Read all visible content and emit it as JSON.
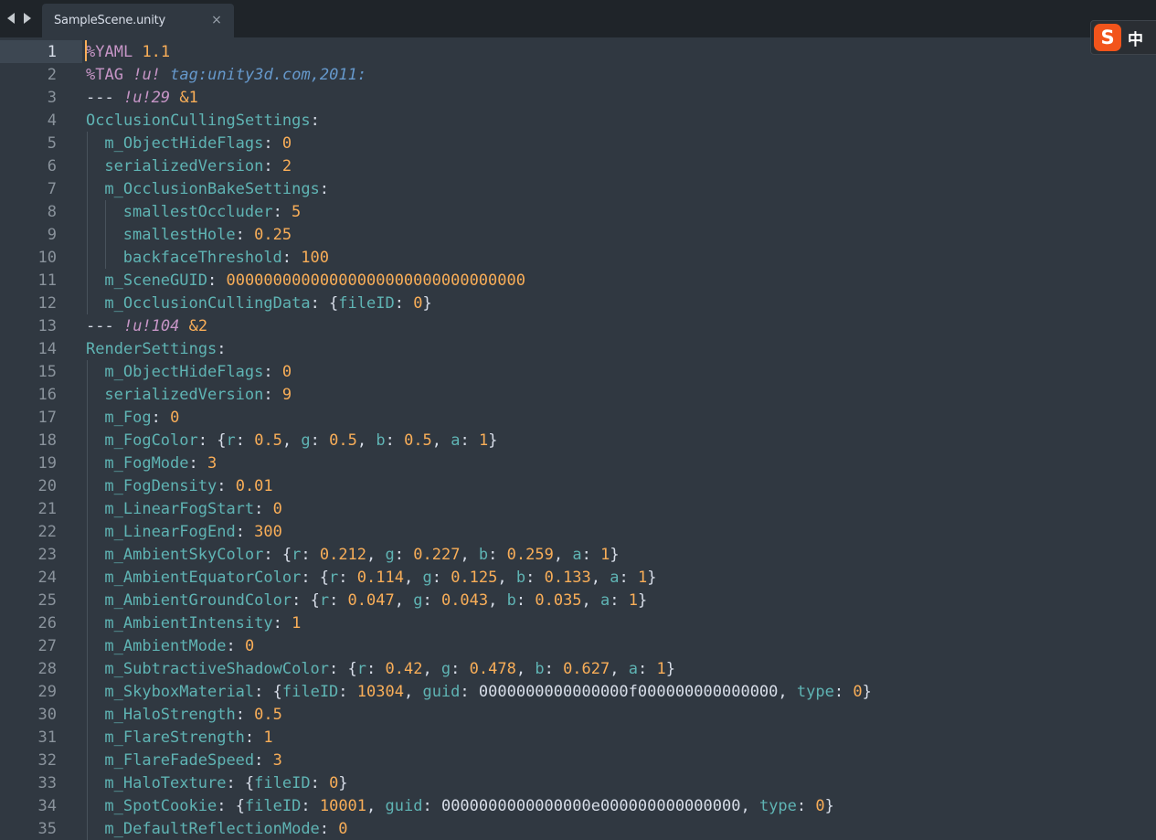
{
  "tab": {
    "title": "SampleScene.unity",
    "close_glyph": "×",
    "back_icon": "triangle-left-icon",
    "forward_icon": "triangle-right-icon"
  },
  "ime": {
    "logo_letter": "S",
    "language": "中"
  },
  "colors": {
    "background": "#303841",
    "tab_bar": "#1f2429",
    "key": "#5fb4b4",
    "number": "#f9ae58",
    "directive": "#c695c6",
    "url": "#6699cc",
    "text": "#d8dee9",
    "caret": "#f9ae58"
  },
  "editor": {
    "current_line": 1,
    "lines": [
      {
        "n": "1",
        "indent": 0,
        "tokens": [
          [
            "dir",
            "%YAML"
          ],
          [
            "pun",
            " "
          ],
          [
            "dirval",
            "1.1"
          ]
        ]
      },
      {
        "n": "2",
        "indent": 0,
        "tokens": [
          [
            "dir",
            "%TAG"
          ],
          [
            "pun",
            " "
          ],
          [
            "ital",
            "!u!"
          ],
          [
            "pun",
            " "
          ],
          [
            "url",
            "tag:unity3d.com,2011:"
          ]
        ]
      },
      {
        "n": "3",
        "indent": 0,
        "tokens": [
          [
            "pun",
            "--- "
          ],
          [
            "ital",
            "!u!29"
          ],
          [
            "pun",
            " "
          ],
          [
            "anchor",
            "&1"
          ]
        ]
      },
      {
        "n": "4",
        "indent": 0,
        "tokens": [
          [
            "key",
            "OcclusionCullingSettings"
          ],
          [
            "pun",
            ":"
          ]
        ]
      },
      {
        "n": "5",
        "indent": 1,
        "tokens": [
          [
            "key",
            "m_ObjectHideFlags"
          ],
          [
            "pun",
            ": "
          ],
          [
            "num",
            "0"
          ]
        ]
      },
      {
        "n": "6",
        "indent": 1,
        "tokens": [
          [
            "key",
            "serializedVersion"
          ],
          [
            "pun",
            ": "
          ],
          [
            "num",
            "2"
          ]
        ]
      },
      {
        "n": "7",
        "indent": 1,
        "tokens": [
          [
            "key",
            "m_OcclusionBakeSettings"
          ],
          [
            "pun",
            ":"
          ]
        ]
      },
      {
        "n": "8",
        "indent": 2,
        "tokens": [
          [
            "key",
            "smallestOccluder"
          ],
          [
            "pun",
            ": "
          ],
          [
            "num",
            "5"
          ]
        ]
      },
      {
        "n": "9",
        "indent": 2,
        "tokens": [
          [
            "key",
            "smallestHole"
          ],
          [
            "pun",
            ": "
          ],
          [
            "num",
            "0.25"
          ]
        ]
      },
      {
        "n": "10",
        "indent": 2,
        "tokens": [
          [
            "key",
            "backfaceThreshold"
          ],
          [
            "pun",
            ": "
          ],
          [
            "num",
            "100"
          ]
        ]
      },
      {
        "n": "11",
        "indent": 1,
        "tokens": [
          [
            "key",
            "m_SceneGUID"
          ],
          [
            "pun",
            ": "
          ],
          [
            "num",
            "00000000000000000000000000000000"
          ]
        ]
      },
      {
        "n": "12",
        "indent": 1,
        "tokens": [
          [
            "key",
            "m_OcclusionCullingData"
          ],
          [
            "pun",
            ": {"
          ],
          [
            "key",
            "fileID"
          ],
          [
            "pun",
            ": "
          ],
          [
            "num",
            "0"
          ],
          [
            "pun",
            "}"
          ]
        ]
      },
      {
        "n": "13",
        "indent": 0,
        "tokens": [
          [
            "pun",
            "--- "
          ],
          [
            "ital",
            "!u!104"
          ],
          [
            "pun",
            " "
          ],
          [
            "anchor",
            "&2"
          ]
        ]
      },
      {
        "n": "14",
        "indent": 0,
        "tokens": [
          [
            "key",
            "RenderSettings"
          ],
          [
            "pun",
            ":"
          ]
        ]
      },
      {
        "n": "15",
        "indent": 1,
        "tokens": [
          [
            "key",
            "m_ObjectHideFlags"
          ],
          [
            "pun",
            ": "
          ],
          [
            "num",
            "0"
          ]
        ]
      },
      {
        "n": "16",
        "indent": 1,
        "tokens": [
          [
            "key",
            "serializedVersion"
          ],
          [
            "pun",
            ": "
          ],
          [
            "num",
            "9"
          ]
        ]
      },
      {
        "n": "17",
        "indent": 1,
        "tokens": [
          [
            "key",
            "m_Fog"
          ],
          [
            "pun",
            ": "
          ],
          [
            "num",
            "0"
          ]
        ]
      },
      {
        "n": "18",
        "indent": 1,
        "tokens": [
          [
            "key",
            "m_FogColor"
          ],
          [
            "pun",
            ": {"
          ],
          [
            "key",
            "r"
          ],
          [
            "pun",
            ": "
          ],
          [
            "num",
            "0.5"
          ],
          [
            "pun",
            ", "
          ],
          [
            "key",
            "g"
          ],
          [
            "pun",
            ": "
          ],
          [
            "num",
            "0.5"
          ],
          [
            "pun",
            ", "
          ],
          [
            "key",
            "b"
          ],
          [
            "pun",
            ": "
          ],
          [
            "num",
            "0.5"
          ],
          [
            "pun",
            ", "
          ],
          [
            "key",
            "a"
          ],
          [
            "pun",
            ": "
          ],
          [
            "num",
            "1"
          ],
          [
            "pun",
            "}"
          ]
        ]
      },
      {
        "n": "19",
        "indent": 1,
        "tokens": [
          [
            "key",
            "m_FogMode"
          ],
          [
            "pun",
            ": "
          ],
          [
            "num",
            "3"
          ]
        ]
      },
      {
        "n": "20",
        "indent": 1,
        "tokens": [
          [
            "key",
            "m_FogDensity"
          ],
          [
            "pun",
            ": "
          ],
          [
            "num",
            "0.01"
          ]
        ]
      },
      {
        "n": "21",
        "indent": 1,
        "tokens": [
          [
            "key",
            "m_LinearFogStart"
          ],
          [
            "pun",
            ": "
          ],
          [
            "num",
            "0"
          ]
        ]
      },
      {
        "n": "22",
        "indent": 1,
        "tokens": [
          [
            "key",
            "m_LinearFogEnd"
          ],
          [
            "pun",
            ": "
          ],
          [
            "num",
            "300"
          ]
        ]
      },
      {
        "n": "23",
        "indent": 1,
        "tokens": [
          [
            "key",
            "m_AmbientSkyColor"
          ],
          [
            "pun",
            ": {"
          ],
          [
            "key",
            "r"
          ],
          [
            "pun",
            ": "
          ],
          [
            "num",
            "0.212"
          ],
          [
            "pun",
            ", "
          ],
          [
            "key",
            "g"
          ],
          [
            "pun",
            ": "
          ],
          [
            "num",
            "0.227"
          ],
          [
            "pun",
            ", "
          ],
          [
            "key",
            "b"
          ],
          [
            "pun",
            ": "
          ],
          [
            "num",
            "0.259"
          ],
          [
            "pun",
            ", "
          ],
          [
            "key",
            "a"
          ],
          [
            "pun",
            ": "
          ],
          [
            "num",
            "1"
          ],
          [
            "pun",
            "}"
          ]
        ]
      },
      {
        "n": "24",
        "indent": 1,
        "tokens": [
          [
            "key",
            "m_AmbientEquatorColor"
          ],
          [
            "pun",
            ": {"
          ],
          [
            "key",
            "r"
          ],
          [
            "pun",
            ": "
          ],
          [
            "num",
            "0.114"
          ],
          [
            "pun",
            ", "
          ],
          [
            "key",
            "g"
          ],
          [
            "pun",
            ": "
          ],
          [
            "num",
            "0.125"
          ],
          [
            "pun",
            ", "
          ],
          [
            "key",
            "b"
          ],
          [
            "pun",
            ": "
          ],
          [
            "num",
            "0.133"
          ],
          [
            "pun",
            ", "
          ],
          [
            "key",
            "a"
          ],
          [
            "pun",
            ": "
          ],
          [
            "num",
            "1"
          ],
          [
            "pun",
            "}"
          ]
        ]
      },
      {
        "n": "25",
        "indent": 1,
        "tokens": [
          [
            "key",
            "m_AmbientGroundColor"
          ],
          [
            "pun",
            ": {"
          ],
          [
            "key",
            "r"
          ],
          [
            "pun",
            ": "
          ],
          [
            "num",
            "0.047"
          ],
          [
            "pun",
            ", "
          ],
          [
            "key",
            "g"
          ],
          [
            "pun",
            ": "
          ],
          [
            "num",
            "0.043"
          ],
          [
            "pun",
            ", "
          ],
          [
            "key",
            "b"
          ],
          [
            "pun",
            ": "
          ],
          [
            "num",
            "0.035"
          ],
          [
            "pun",
            ", "
          ],
          [
            "key",
            "a"
          ],
          [
            "pun",
            ": "
          ],
          [
            "num",
            "1"
          ],
          [
            "pun",
            "}"
          ]
        ]
      },
      {
        "n": "26",
        "indent": 1,
        "tokens": [
          [
            "key",
            "m_AmbientIntensity"
          ],
          [
            "pun",
            ": "
          ],
          [
            "num",
            "1"
          ]
        ]
      },
      {
        "n": "27",
        "indent": 1,
        "tokens": [
          [
            "key",
            "m_AmbientMode"
          ],
          [
            "pun",
            ": "
          ],
          [
            "num",
            "0"
          ]
        ]
      },
      {
        "n": "28",
        "indent": 1,
        "tokens": [
          [
            "key",
            "m_SubtractiveShadowColor"
          ],
          [
            "pun",
            ": {"
          ],
          [
            "key",
            "r"
          ],
          [
            "pun",
            ": "
          ],
          [
            "num",
            "0.42"
          ],
          [
            "pun",
            ", "
          ],
          [
            "key",
            "g"
          ],
          [
            "pun",
            ": "
          ],
          [
            "num",
            "0.478"
          ],
          [
            "pun",
            ", "
          ],
          [
            "key",
            "b"
          ],
          [
            "pun",
            ": "
          ],
          [
            "num",
            "0.627"
          ],
          [
            "pun",
            ", "
          ],
          [
            "key",
            "a"
          ],
          [
            "pun",
            ": "
          ],
          [
            "num",
            "1"
          ],
          [
            "pun",
            "}"
          ]
        ]
      },
      {
        "n": "29",
        "indent": 1,
        "tokens": [
          [
            "key",
            "m_SkyboxMaterial"
          ],
          [
            "pun",
            ": {"
          ],
          [
            "key",
            "fileID"
          ],
          [
            "pun",
            ": "
          ],
          [
            "num",
            "10304"
          ],
          [
            "pun",
            ", "
          ],
          [
            "key",
            "guid"
          ],
          [
            "pun",
            ": "
          ],
          [
            "val",
            "0000000000000000f000000000000000"
          ],
          [
            "pun",
            ", "
          ],
          [
            "key",
            "type"
          ],
          [
            "pun",
            ": "
          ],
          [
            "num",
            "0"
          ],
          [
            "pun",
            "}"
          ]
        ]
      },
      {
        "n": "30",
        "indent": 1,
        "tokens": [
          [
            "key",
            "m_HaloStrength"
          ],
          [
            "pun",
            ": "
          ],
          [
            "num",
            "0.5"
          ]
        ]
      },
      {
        "n": "31",
        "indent": 1,
        "tokens": [
          [
            "key",
            "m_FlareStrength"
          ],
          [
            "pun",
            ": "
          ],
          [
            "num",
            "1"
          ]
        ]
      },
      {
        "n": "32",
        "indent": 1,
        "tokens": [
          [
            "key",
            "m_FlareFadeSpeed"
          ],
          [
            "pun",
            ": "
          ],
          [
            "num",
            "3"
          ]
        ]
      },
      {
        "n": "33",
        "indent": 1,
        "tokens": [
          [
            "key",
            "m_HaloTexture"
          ],
          [
            "pun",
            ": {"
          ],
          [
            "key",
            "fileID"
          ],
          [
            "pun",
            ": "
          ],
          [
            "num",
            "0"
          ],
          [
            "pun",
            "}"
          ]
        ]
      },
      {
        "n": "34",
        "indent": 1,
        "tokens": [
          [
            "key",
            "m_SpotCookie"
          ],
          [
            "pun",
            ": {"
          ],
          [
            "key",
            "fileID"
          ],
          [
            "pun",
            ": "
          ],
          [
            "num",
            "10001"
          ],
          [
            "pun",
            ", "
          ],
          [
            "key",
            "guid"
          ],
          [
            "pun",
            ": "
          ],
          [
            "val",
            "0000000000000000e000000000000000"
          ],
          [
            "pun",
            ", "
          ],
          [
            "key",
            "type"
          ],
          [
            "pun",
            ": "
          ],
          [
            "num",
            "0"
          ],
          [
            "pun",
            "}"
          ]
        ]
      },
      {
        "n": "35",
        "indent": 1,
        "tokens": [
          [
            "key",
            "m_DefaultReflectionMode"
          ],
          [
            "pun",
            ": "
          ],
          [
            "num",
            "0"
          ]
        ]
      }
    ]
  }
}
